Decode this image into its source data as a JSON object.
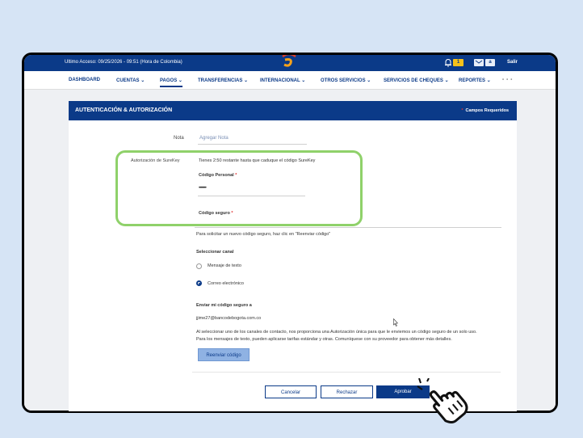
{
  "topbar": {
    "last_access": "Ultimo Acceso: 09/25/2026 - 09:51 (Hora de Colombia)",
    "badge": "1",
    "user_btn": "a",
    "logout": "Salir"
  },
  "nav": {
    "items": [
      "DASHBOARD",
      "CUENTAS",
      "PAGOS",
      "TRANSFERENCIAS",
      "INTERNACIONAL",
      "OTROS SERVICIOS",
      "SERVICIOS DE CHEQUES",
      "REPORTES"
    ],
    "active": "PAGOS"
  },
  "card": {
    "title": "AUTENTICACIÓN & AUTORIZACIÓN",
    "required_star": "*",
    "required": "Campos Requeridos"
  },
  "form": {
    "note_label": "Nota",
    "note_placeholder": "Agregar Nota",
    "surekey_label": "Autorización de SureKey",
    "surekey_info": "Tienes 2:50 restante hasta que caduque el código SureKey",
    "personal_code_label": "Código Personal",
    "personal_code_value": "••••••••",
    "secure_code_label": "Código seguro",
    "resend_info": "Para solicitar un nuevo código seguro, haz clic en \"Reenviar código\"",
    "channel_label": "Seleccionar canal",
    "channel_options": [
      "Mensaje de texto",
      "Correo electrónico"
    ],
    "send_to_label": "Enviar mi código seguro a",
    "email": "jjime27@bancodebogota.com.co",
    "disclaimer_1": "Al seleccionar uno de los canales de contacto, nos proporciona una Autorización única para que le enviemos un código seguro de un solo uso.",
    "disclaimer_2": "Para los mensajes de texto, pueden aplicarse tarifas estándar y otras. Comuníquese con su proveedor para obtener más detalles.",
    "resend_button": "Reenviar código"
  },
  "actions": {
    "cancel": "Cancelar",
    "reject": "Rechazar",
    "approve": "Aprobar"
  },
  "colors": {
    "brand_blue": "#0b3a88",
    "highlight_green": "#8fd16a",
    "background": "#d6e4f5"
  }
}
